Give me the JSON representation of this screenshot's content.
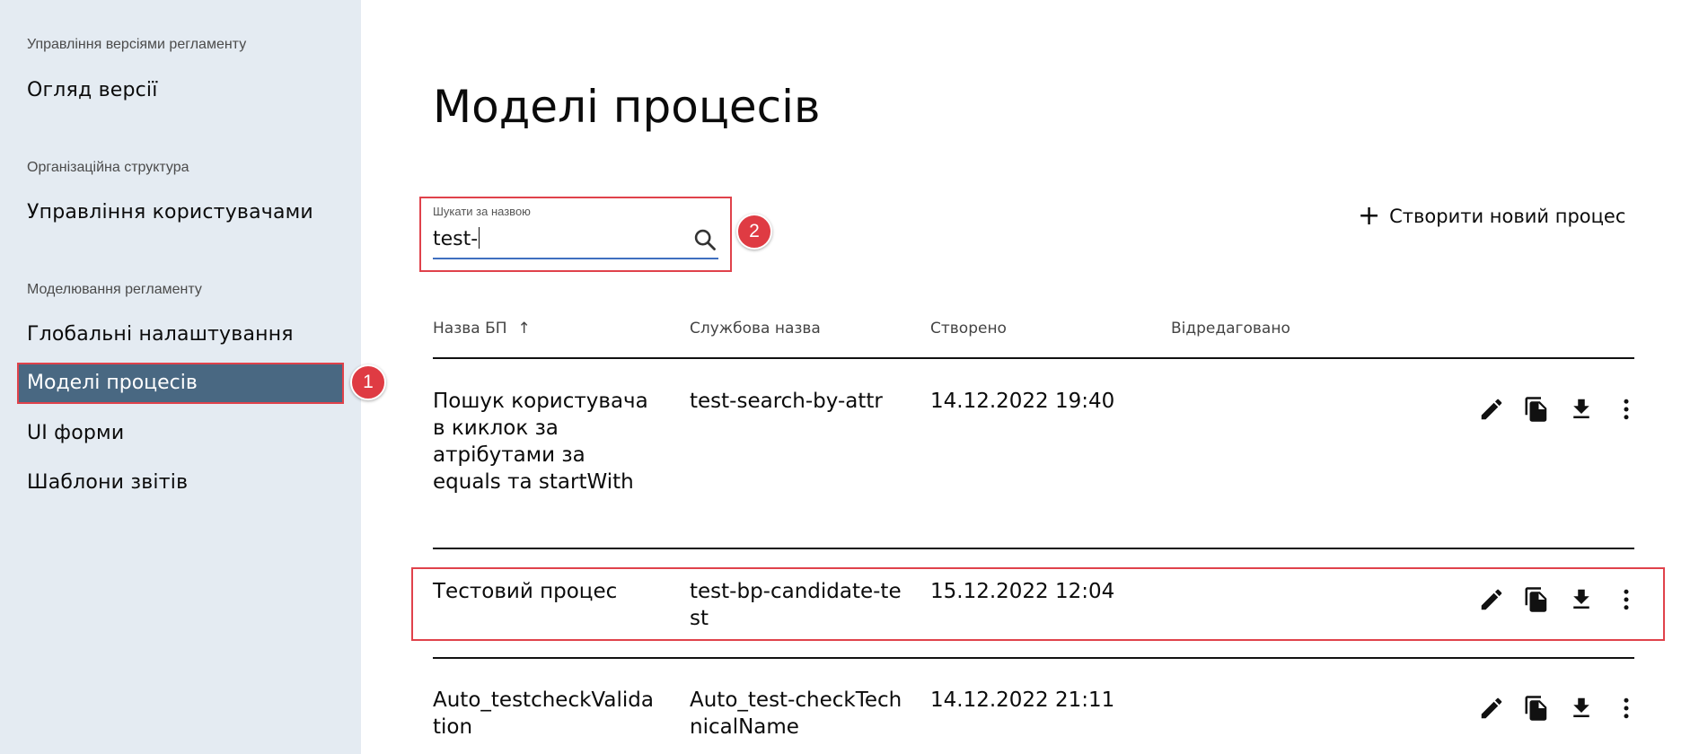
{
  "sidebar": {
    "section_versions": "Управління версіями регламенту",
    "item_version_overview": "Огляд версії",
    "section_org": "Організаційна структура",
    "item_user_management": "Управління користувачами",
    "section_modeling": "Моделювання регламенту",
    "item_global_settings": "Глобальні налаштування",
    "item_process_models": "Моделі процесів",
    "item_ui_forms": "UI форми",
    "item_report_templates": "Шаблони звітів"
  },
  "badges": {
    "one": "1",
    "two": "2"
  },
  "page": {
    "title": "Моделі процесів"
  },
  "search": {
    "label": "Шукати за назвою",
    "value": "test-",
    "icon": "search-icon"
  },
  "create": {
    "icon": "plus-icon",
    "label": "Створити новий процес"
  },
  "table": {
    "headers": {
      "name": "Назва БП",
      "sort_icon": "↑",
      "system_name": "Службова назва",
      "created": "Створено",
      "edited": "Відредаговано"
    },
    "rows": [
      {
        "name": "Пошук користувача в киклок за атрібутами за equals та startWith",
        "system_name": "test-search-by-attr",
        "created": "14.12.2022 19:40",
        "edited": ""
      },
      {
        "name": "Тестовий процес",
        "system_name": "test-bp-candidate-test",
        "created": "15.12.2022 12:04",
        "edited": ""
      },
      {
        "name": "Auto_testcheckValidation",
        "system_name": "Auto_test-checkTechnicalName",
        "created": "14.12.2022 21:11",
        "edited": ""
      }
    ],
    "row_actions": [
      "edit-icon",
      "copy-icon",
      "download-icon",
      "more-vert-icon"
    ]
  },
  "colors": {
    "sidebar_bg": "#e4ebf2",
    "active_item_bg": "#496882",
    "highlight": "#e0424b",
    "search_underline": "#3f6fbf"
  }
}
